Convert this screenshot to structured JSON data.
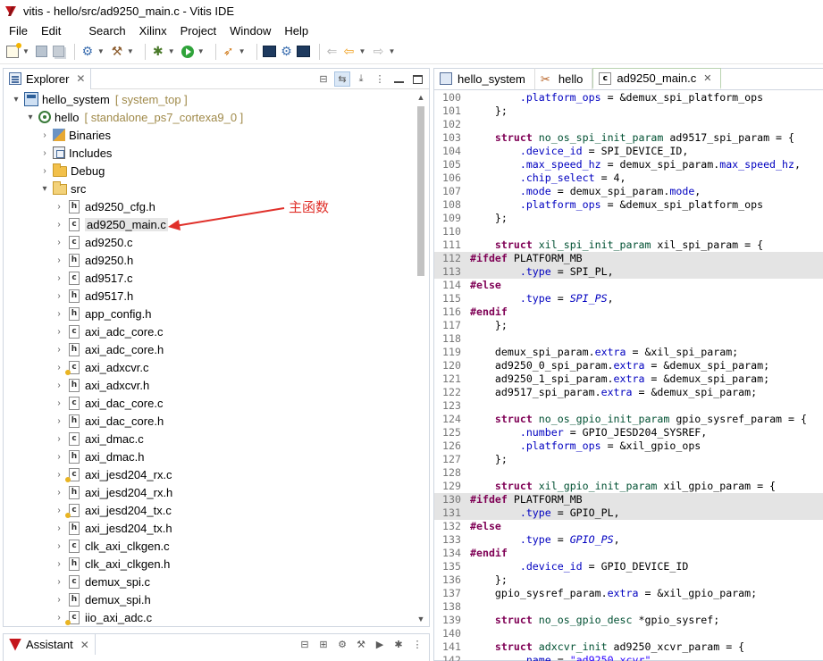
{
  "window": {
    "title": "vitis - hello/src/ad9250_main.c - Vitis IDE"
  },
  "menu": [
    "File",
    "Edit",
    "Search",
    "Xilinx",
    "Project",
    "Window",
    "Help"
  ],
  "explorer": {
    "tab_label": "Explorer",
    "tree": [
      {
        "depth": 0,
        "twisty": "▾",
        "icon": "project",
        "label": "hello_system",
        "deco": "[ system_top ]"
      },
      {
        "depth": 1,
        "twisty": "▾",
        "icon": "app",
        "label": "hello",
        "deco": "[ standalone_ps7_cortexa9_0 ]"
      },
      {
        "depth": 2,
        "twisty": "›",
        "icon": "binaries",
        "label": "Binaries"
      },
      {
        "depth": 2,
        "twisty": "›",
        "icon": "includes",
        "label": "Includes"
      },
      {
        "depth": 2,
        "twisty": "›",
        "icon": "folder",
        "label": "Debug"
      },
      {
        "depth": 2,
        "twisty": "▾",
        "icon": "src-folder",
        "label": "src"
      },
      {
        "depth": 3,
        "twisty": "›",
        "icon": "h",
        "label": "ad9250_cfg.h"
      },
      {
        "depth": 3,
        "twisty": "›",
        "icon": "c",
        "label": "ad9250_main.c",
        "selected": true
      },
      {
        "depth": 3,
        "twisty": "›",
        "icon": "c",
        "label": "ad9250.c"
      },
      {
        "depth": 3,
        "twisty": "›",
        "icon": "h",
        "label": "ad9250.h"
      },
      {
        "depth": 3,
        "twisty": "›",
        "icon": "c",
        "label": "ad9517.c"
      },
      {
        "depth": 3,
        "twisty": "›",
        "icon": "h",
        "label": "ad9517.h"
      },
      {
        "depth": 3,
        "twisty": "›",
        "icon": "h",
        "label": "app_config.h"
      },
      {
        "depth": 3,
        "twisty": "›",
        "icon": "c",
        "label": "axi_adc_core.c"
      },
      {
        "depth": 3,
        "twisty": "›",
        "icon": "h",
        "label": "axi_adc_core.h"
      },
      {
        "depth": 3,
        "twisty": "›",
        "icon": "c-warn",
        "label": "axi_adxcvr.c"
      },
      {
        "depth": 3,
        "twisty": "›",
        "icon": "h",
        "label": "axi_adxcvr.h"
      },
      {
        "depth": 3,
        "twisty": "›",
        "icon": "c",
        "label": "axi_dac_core.c"
      },
      {
        "depth": 3,
        "twisty": "›",
        "icon": "h",
        "label": "axi_dac_core.h"
      },
      {
        "depth": 3,
        "twisty": "›",
        "icon": "c",
        "label": "axi_dmac.c"
      },
      {
        "depth": 3,
        "twisty": "›",
        "icon": "h",
        "label": "axi_dmac.h"
      },
      {
        "depth": 3,
        "twisty": "›",
        "icon": "c-warn",
        "label": "axi_jesd204_rx.c"
      },
      {
        "depth": 3,
        "twisty": "›",
        "icon": "h",
        "label": "axi_jesd204_rx.h"
      },
      {
        "depth": 3,
        "twisty": "›",
        "icon": "c-warn",
        "label": "axi_jesd204_tx.c"
      },
      {
        "depth": 3,
        "twisty": "›",
        "icon": "h",
        "label": "axi_jesd204_tx.h"
      },
      {
        "depth": 3,
        "twisty": "›",
        "icon": "c",
        "label": "clk_axi_clkgen.c"
      },
      {
        "depth": 3,
        "twisty": "›",
        "icon": "h",
        "label": "clk_axi_clkgen.h"
      },
      {
        "depth": 3,
        "twisty": "›",
        "icon": "c",
        "label": "demux_spi.c"
      },
      {
        "depth": 3,
        "twisty": "›",
        "icon": "h",
        "label": "demux_spi.h"
      },
      {
        "depth": 3,
        "twisty": "›",
        "icon": "c-warn",
        "label": "iio_axi_adc.c"
      }
    ]
  },
  "annotation": {
    "text": "主函数",
    "color": "#e0302a"
  },
  "assistant": {
    "tab_label": "Assistant"
  },
  "editor": {
    "tabs": [
      {
        "label": "hello_system",
        "icon": "system",
        "active": false
      },
      {
        "label": "hello",
        "icon": "tools",
        "active": false
      },
      {
        "label": "ad9250_main.c",
        "icon": "c-file",
        "active": true
      }
    ],
    "lines": [
      {
        "n": "100",
        "segs": [
          [
            "",
            "        "
          ],
          [
            "fld",
            ".platform_ops"
          ],
          [
            "",
            " = &demux_spi_platform_ops"
          ]
        ]
      },
      {
        "n": "101",
        "segs": [
          [
            "",
            "    };"
          ]
        ]
      },
      {
        "n": "102",
        "segs": []
      },
      {
        "n": "103",
        "segs": [
          [
            "",
            "    "
          ],
          [
            "kw",
            "struct"
          ],
          [
            "",
            " "
          ],
          [
            "ty",
            "no_os_spi_init_param"
          ],
          [
            "",
            " ad9517_spi_param = {"
          ]
        ]
      },
      {
        "n": "104",
        "segs": [
          [
            "",
            "        "
          ],
          [
            "fld",
            ".device_id"
          ],
          [
            "",
            " = SPI_DEVICE_ID,"
          ]
        ]
      },
      {
        "n": "105",
        "segs": [
          [
            "",
            "        "
          ],
          [
            "fld",
            ".max_speed_hz"
          ],
          [
            "",
            " = demux_spi_param."
          ],
          [
            "fld",
            "max_speed_hz"
          ],
          [
            "",
            ","
          ]
        ]
      },
      {
        "n": "106",
        "segs": [
          [
            "",
            "        "
          ],
          [
            "fld",
            ".chip_select"
          ],
          [
            "",
            " = 4,"
          ]
        ]
      },
      {
        "n": "107",
        "segs": [
          [
            "",
            "        "
          ],
          [
            "fld",
            ".mode"
          ],
          [
            "",
            " = demux_spi_param."
          ],
          [
            "fld",
            "mode"
          ],
          [
            "",
            ","
          ]
        ]
      },
      {
        "n": "108",
        "segs": [
          [
            "",
            "        "
          ],
          [
            "fld",
            ".platform_ops"
          ],
          [
            "",
            " = &demux_spi_platform_ops"
          ]
        ]
      },
      {
        "n": "109",
        "segs": [
          [
            "",
            "    };"
          ]
        ]
      },
      {
        "n": "110",
        "segs": []
      },
      {
        "n": "111",
        "segs": [
          [
            "",
            "    "
          ],
          [
            "kw",
            "struct"
          ],
          [
            "",
            " "
          ],
          [
            "ty",
            "xil_spi_init_param"
          ],
          [
            "",
            " xil_spi_param = {"
          ]
        ]
      },
      {
        "n": "112",
        "hl": true,
        "segs": [
          [
            "kw",
            "#ifdef"
          ],
          [
            "",
            " PLATFORM_MB"
          ]
        ]
      },
      {
        "n": "113",
        "hl": true,
        "segs": [
          [
            "",
            "        "
          ],
          [
            "fld",
            ".type"
          ],
          [
            "",
            " = SPI_PL,"
          ]
        ]
      },
      {
        "n": "114",
        "segs": [
          [
            "kw",
            "#else"
          ]
        ]
      },
      {
        "n": "115",
        "segs": [
          [
            "",
            "        "
          ],
          [
            "fld",
            ".type"
          ],
          [
            "",
            " = "
          ],
          [
            "ital",
            "SPI_PS"
          ],
          [
            "",
            ","
          ]
        ]
      },
      {
        "n": "116",
        "segs": [
          [
            "kw",
            "#endif"
          ]
        ]
      },
      {
        "n": "117",
        "segs": [
          [
            "",
            "    };"
          ]
        ]
      },
      {
        "n": "118",
        "segs": []
      },
      {
        "n": "119",
        "segs": [
          [
            "",
            "    demux_spi_param."
          ],
          [
            "fld",
            "extra"
          ],
          [
            "",
            " = &xil_spi_param;"
          ]
        ]
      },
      {
        "n": "120",
        "segs": [
          [
            "",
            "    ad9250_0_spi_param."
          ],
          [
            "fld",
            "extra"
          ],
          [
            "",
            " = &demux_spi_param;"
          ]
        ]
      },
      {
        "n": "121",
        "segs": [
          [
            "",
            "    ad9250_1_spi_param."
          ],
          [
            "fld",
            "extra"
          ],
          [
            "",
            " = &demux_spi_param;"
          ]
        ]
      },
      {
        "n": "122",
        "segs": [
          [
            "",
            "    ad9517_spi_param."
          ],
          [
            "fld",
            "extra"
          ],
          [
            "",
            " = &demux_spi_param;"
          ]
        ]
      },
      {
        "n": "123",
        "segs": []
      },
      {
        "n": "124",
        "segs": [
          [
            "",
            "    "
          ],
          [
            "kw",
            "struct"
          ],
          [
            "",
            " "
          ],
          [
            "ty",
            "no_os_gpio_init_param"
          ],
          [
            "",
            " gpio_sysref_param = {"
          ]
        ]
      },
      {
        "n": "125",
        "segs": [
          [
            "",
            "        "
          ],
          [
            "fld",
            ".number"
          ],
          [
            "",
            " = GPIO_JESD204_SYSREF,"
          ]
        ]
      },
      {
        "n": "126",
        "segs": [
          [
            "",
            "        "
          ],
          [
            "fld",
            ".platform_ops"
          ],
          [
            "",
            " = &xil_gpio_ops"
          ]
        ]
      },
      {
        "n": "127",
        "segs": [
          [
            "",
            "    };"
          ]
        ]
      },
      {
        "n": "128",
        "segs": []
      },
      {
        "n": "129",
        "segs": [
          [
            "",
            "    "
          ],
          [
            "kw",
            "struct"
          ],
          [
            "",
            " "
          ],
          [
            "ty",
            "xil_gpio_init_param"
          ],
          [
            "",
            " xil_gpio_param = {"
          ]
        ]
      },
      {
        "n": "130",
        "hl": true,
        "segs": [
          [
            "kw",
            "#ifdef"
          ],
          [
            "",
            " PLATFORM_MB"
          ]
        ]
      },
      {
        "n": "131",
        "hl": true,
        "segs": [
          [
            "",
            "        "
          ],
          [
            "fld",
            ".type"
          ],
          [
            "",
            " = GPIO_PL,"
          ]
        ]
      },
      {
        "n": "132",
        "segs": [
          [
            "kw",
            "#else"
          ]
        ]
      },
      {
        "n": "133",
        "segs": [
          [
            "",
            "        "
          ],
          [
            "fld",
            ".type"
          ],
          [
            "",
            " = "
          ],
          [
            "ital",
            "GPIO_PS"
          ],
          [
            "",
            ","
          ]
        ]
      },
      {
        "n": "134",
        "segs": [
          [
            "kw",
            "#endif"
          ]
        ]
      },
      {
        "n": "135",
        "segs": [
          [
            "",
            "        "
          ],
          [
            "fld",
            ".device_id"
          ],
          [
            "",
            " = GPIO_DEVICE_ID"
          ]
        ]
      },
      {
        "n": "136",
        "segs": [
          [
            "",
            "    };"
          ]
        ]
      },
      {
        "n": "137",
        "segs": [
          [
            "",
            "    gpio_sysref_param."
          ],
          [
            "fld",
            "extra"
          ],
          [
            "",
            " = &xil_gpio_param;"
          ]
        ]
      },
      {
        "n": "138",
        "segs": []
      },
      {
        "n": "139",
        "segs": [
          [
            "",
            "    "
          ],
          [
            "kw",
            "struct"
          ],
          [
            "",
            " "
          ],
          [
            "ty",
            "no_os_gpio_desc"
          ],
          [
            "",
            " *gpio_sysref;"
          ]
        ]
      },
      {
        "n": "140",
        "segs": []
      },
      {
        "n": "141",
        "segs": [
          [
            "",
            "    "
          ],
          [
            "kw",
            "struct"
          ],
          [
            "",
            " "
          ],
          [
            "ty",
            "adxcvr_init"
          ],
          [
            "",
            " ad9250_xcvr_param = {"
          ]
        ]
      },
      {
        "n": "142",
        "segs": [
          [
            "",
            "        "
          ],
          [
            "fld",
            ".name"
          ],
          [
            "",
            " = "
          ],
          [
            "str",
            "\"ad9250_xcvr\""
          ]
        ]
      }
    ]
  }
}
